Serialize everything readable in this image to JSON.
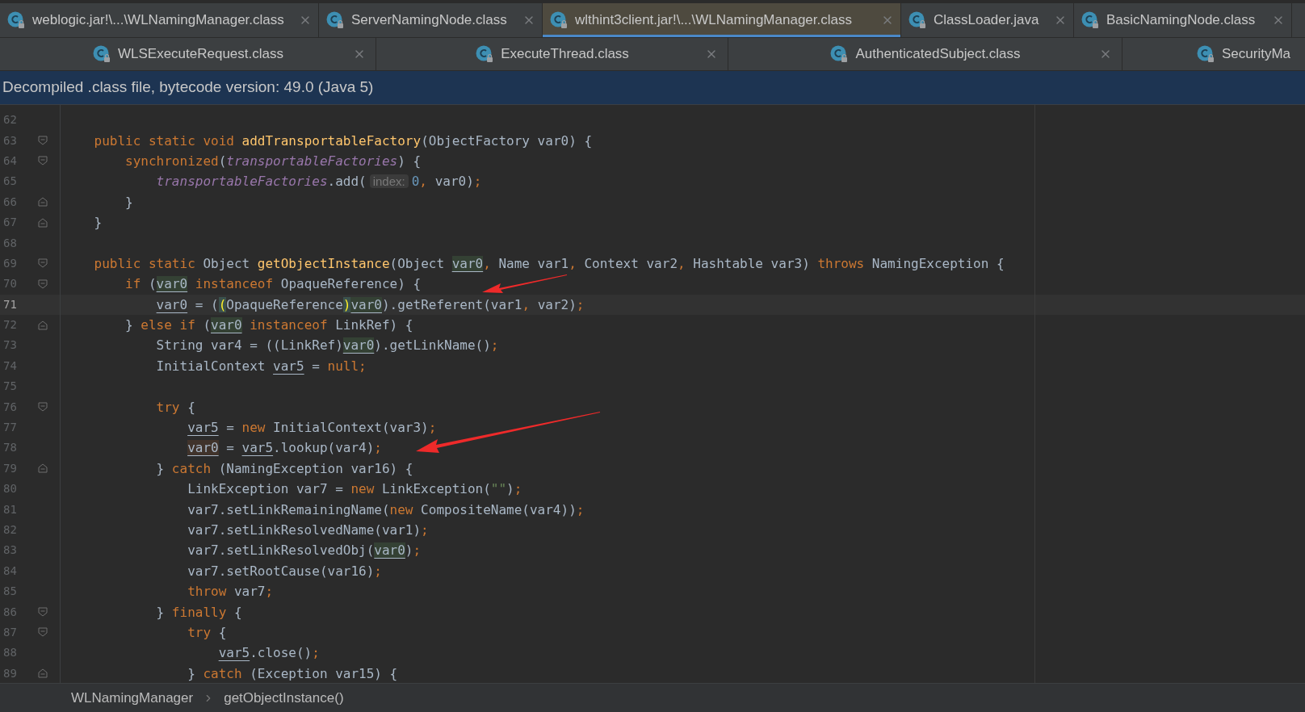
{
  "tab_rows": [
    [
      {
        "label": "weblogic.jar!\\...\\WLNamingManager.class",
        "selected": false
      },
      {
        "label": "ServerNamingNode.class",
        "selected": false
      },
      {
        "label": "wlthint3client.jar!\\...\\WLNamingManager.class",
        "selected": true
      },
      {
        "label": "ClassLoader.java",
        "selected": false
      },
      {
        "label": "BasicNamingNode.class",
        "selected": false
      }
    ],
    [
      {
        "label": "WLSExecuteRequest.class",
        "selected": false
      },
      {
        "label": "ExecuteThread.class",
        "selected": false
      },
      {
        "label": "AuthenticatedSubject.class",
        "selected": false
      },
      {
        "label": "SecurityMa",
        "selected": false
      }
    ]
  ],
  "banner": "Decompiled .class file, bytecode version: 49.0 (Java 5)",
  "editor": {
    "lines": [
      {
        "number": "62",
        "current": false,
        "fold_start": false,
        "fold_end": false
      },
      {
        "number": "63",
        "current": false,
        "fold_start": true,
        "fold_end": false,
        "tokens": [
          {
            "kind": "kw",
            "text": "    public static void "
          },
          {
            "kind": "fn",
            "text": "addTransportableFactory"
          },
          {
            "kind": "p",
            "text": "(ObjectFactory var0) {"
          }
        ]
      },
      {
        "number": "64",
        "current": false,
        "fold_start": true,
        "fold_end": false,
        "tokens": [
          {
            "kind": "kw",
            "text": "        synchronized"
          },
          {
            "kind": "p",
            "text": "("
          },
          {
            "kind": "fld",
            "text": "transportableFactories"
          },
          {
            "kind": "p",
            "text": ") {"
          }
        ]
      },
      {
        "number": "65",
        "current": false,
        "fold_start": false,
        "fold_end": false,
        "tokens": [
          {
            "kind": "fld",
            "text": "            transportableFactories"
          },
          {
            "kind": "p",
            "text": ".add("
          },
          {
            "kind": "hint",
            "text": "index:"
          },
          {
            "kind": "num",
            "text": "0"
          },
          {
            "kind": "kw",
            "text": ", "
          },
          {
            "kind": "p",
            "text": "var0)"
          },
          {
            "kind": "kw",
            "text": ";"
          }
        ]
      },
      {
        "number": "66",
        "current": false,
        "fold_start": false,
        "fold_end": true,
        "tokens": [
          {
            "kind": "p",
            "text": "        }"
          }
        ]
      },
      {
        "number": "67",
        "current": false,
        "fold_start": false,
        "fold_end": true,
        "tokens": [
          {
            "kind": "p",
            "text": "    }"
          }
        ]
      },
      {
        "number": "68",
        "current": false,
        "fold_start": false,
        "fold_end": false
      },
      {
        "number": "69",
        "current": false,
        "fold_start": true,
        "fold_end": false,
        "tokens": [
          {
            "kind": "kw",
            "text": "    public static "
          },
          {
            "kind": "p",
            "text": "Object "
          },
          {
            "kind": "fn",
            "text": "getObjectInstance"
          },
          {
            "kind": "p",
            "text": "(Object "
          },
          {
            "kind": "vh",
            "text": "var0"
          },
          {
            "kind": "kw",
            "text": ", "
          },
          {
            "kind": "p",
            "text": "Name var1"
          },
          {
            "kind": "kw",
            "text": ", "
          },
          {
            "kind": "p",
            "text": "Context var2"
          },
          {
            "kind": "kw",
            "text": ", "
          },
          {
            "kind": "p",
            "text": "Hashtable var3) "
          },
          {
            "kind": "kw",
            "text": "throws "
          },
          {
            "kind": "p",
            "text": "NamingException {"
          }
        ]
      },
      {
        "number": "70",
        "current": false,
        "fold_start": true,
        "fold_end": false,
        "tokens": [
          {
            "kind": "kw",
            "text": "        if "
          },
          {
            "kind": "p",
            "text": "("
          },
          {
            "kind": "vh",
            "text": "var0"
          },
          {
            "kind": "kw",
            "text": " instanceof "
          },
          {
            "kind": "p",
            "text": "OpaqueReference) {"
          }
        ]
      },
      {
        "number": "71",
        "current": true,
        "fold_start": false,
        "fold_end": false,
        "tokens": [
          {
            "kind": "v",
            "text": "            var0"
          },
          {
            "kind": "p",
            "text": " = ("
          },
          {
            "kind": "br",
            "text": "("
          },
          {
            "kind": "p",
            "text": "OpaqueReference"
          },
          {
            "kind": "br",
            "text": ")"
          },
          {
            "kind": "vh",
            "text": "var0"
          },
          {
            "kind": "p",
            "text": ").getReferent(var1"
          },
          {
            "kind": "kw",
            "text": ", "
          },
          {
            "kind": "p",
            "text": "var2)"
          },
          {
            "kind": "kw",
            "text": ";"
          }
        ]
      },
      {
        "number": "72",
        "current": false,
        "fold_start": false,
        "fold_end": true,
        "tokens": [
          {
            "kind": "p",
            "text": "        } "
          },
          {
            "kind": "kw",
            "text": "else if "
          },
          {
            "kind": "p",
            "text": "("
          },
          {
            "kind": "vh",
            "text": "var0"
          },
          {
            "kind": "kw",
            "text": " instanceof "
          },
          {
            "kind": "p",
            "text": "LinkRef) {"
          }
        ]
      },
      {
        "number": "73",
        "current": false,
        "fold_start": false,
        "fold_end": false,
        "tokens": [
          {
            "kind": "p",
            "text": "            String var4 = ((LinkRef)"
          },
          {
            "kind": "vh",
            "text": "var0"
          },
          {
            "kind": "p",
            "text": ").getLinkName()"
          },
          {
            "kind": "kw",
            "text": ";"
          }
        ]
      },
      {
        "number": "74",
        "current": false,
        "fold_start": false,
        "fold_end": false,
        "tokens": [
          {
            "kind": "p",
            "text": "            InitialContext "
          },
          {
            "kind": "v",
            "text": "var5"
          },
          {
            "kind": "p",
            "text": " = "
          },
          {
            "kind": "kw",
            "text": "null;"
          }
        ]
      },
      {
        "number": "75",
        "current": false,
        "fold_start": false,
        "fold_end": false
      },
      {
        "number": "76",
        "current": false,
        "fold_start": true,
        "fold_end": false,
        "tokens": [
          {
            "kind": "kw",
            "text": "            try "
          },
          {
            "kind": "p",
            "text": "{"
          }
        ]
      },
      {
        "number": "77",
        "current": false,
        "fold_start": false,
        "fold_end": false,
        "tokens": [
          {
            "kind": "v",
            "text": "                var5"
          },
          {
            "kind": "p",
            "text": " = "
          },
          {
            "kind": "kw",
            "text": "new "
          },
          {
            "kind": "p",
            "text": "InitialContext(var3)"
          },
          {
            "kind": "kw",
            "text": ";"
          }
        ]
      },
      {
        "number": "78",
        "current": false,
        "fold_start": false,
        "fold_end": false,
        "tokens": [
          {
            "kind": "vw",
            "text": "                var0"
          },
          {
            "kind": "p",
            "text": " = "
          },
          {
            "kind": "v",
            "text": "var5"
          },
          {
            "kind": "p",
            "text": ".lookup(var4)"
          },
          {
            "kind": "kw",
            "text": ";"
          }
        ]
      },
      {
        "number": "79",
        "current": false,
        "fold_start": false,
        "fold_end": true,
        "tokens": [
          {
            "kind": "p",
            "text": "            } "
          },
          {
            "kind": "kw",
            "text": "catch "
          },
          {
            "kind": "p",
            "text": "(NamingException var16) {"
          }
        ]
      },
      {
        "number": "80",
        "current": false,
        "fold_start": false,
        "fold_end": false,
        "tokens": [
          {
            "kind": "p",
            "text": "                LinkException var7 = "
          },
          {
            "kind": "kw",
            "text": "new "
          },
          {
            "kind": "p",
            "text": "LinkException("
          },
          {
            "kind": "str",
            "text": "\"\""
          },
          {
            "kind": "p",
            "text": ")"
          },
          {
            "kind": "kw",
            "text": ";"
          }
        ]
      },
      {
        "number": "81",
        "current": false,
        "fold_start": false,
        "fold_end": false,
        "tokens": [
          {
            "kind": "p",
            "text": "                var7.setLinkRemainingName("
          },
          {
            "kind": "kw",
            "text": "new "
          },
          {
            "kind": "p",
            "text": "CompositeName(var4))"
          },
          {
            "kind": "kw",
            "text": ";"
          }
        ]
      },
      {
        "number": "82",
        "current": false,
        "fold_start": false,
        "fold_end": false,
        "tokens": [
          {
            "kind": "p",
            "text": "                var7.setLinkResolvedName(var1)"
          },
          {
            "kind": "kw",
            "text": ";"
          }
        ]
      },
      {
        "number": "83",
        "current": false,
        "fold_start": false,
        "fold_end": false,
        "tokens": [
          {
            "kind": "p",
            "text": "                var7.setLinkResolvedObj("
          },
          {
            "kind": "vh",
            "text": "var0"
          },
          {
            "kind": "p",
            "text": ")"
          },
          {
            "kind": "kw",
            "text": ";"
          }
        ]
      },
      {
        "number": "84",
        "current": false,
        "fold_start": false,
        "fold_end": false,
        "tokens": [
          {
            "kind": "p",
            "text": "                var7.setRootCause(var16)"
          },
          {
            "kind": "kw",
            "text": ";"
          }
        ]
      },
      {
        "number": "85",
        "current": false,
        "fold_start": false,
        "fold_end": false,
        "tokens": [
          {
            "kind": "kw",
            "text": "                throw "
          },
          {
            "kind": "p",
            "text": "var7"
          },
          {
            "kind": "kw",
            "text": ";"
          }
        ]
      },
      {
        "number": "86",
        "current": false,
        "fold_start": true,
        "fold_end": false,
        "tokens": [
          {
            "kind": "p",
            "text": "            } "
          },
          {
            "kind": "kw",
            "text": "finally "
          },
          {
            "kind": "p",
            "text": "{"
          }
        ]
      },
      {
        "number": "87",
        "current": false,
        "fold_start": true,
        "fold_end": false,
        "tokens": [
          {
            "kind": "kw",
            "text": "                try "
          },
          {
            "kind": "p",
            "text": "{"
          }
        ]
      },
      {
        "number": "88",
        "current": false,
        "fold_start": false,
        "fold_end": false,
        "tokens": [
          {
            "kind": "v",
            "text": "                    var5"
          },
          {
            "kind": "p",
            "text": ".close()"
          },
          {
            "kind": "kw",
            "text": ";"
          }
        ]
      },
      {
        "number": "89",
        "current": false,
        "fold_start": false,
        "fold_end": true,
        "tokens": [
          {
            "kind": "p",
            "text": "                } "
          },
          {
            "kind": "kw",
            "text": "catch "
          },
          {
            "kind": "p",
            "text": "(Exception var15) {"
          }
        ]
      }
    ]
  },
  "breadcrumbs": [
    "WLNamingManager",
    "getObjectInstance()"
  ]
}
